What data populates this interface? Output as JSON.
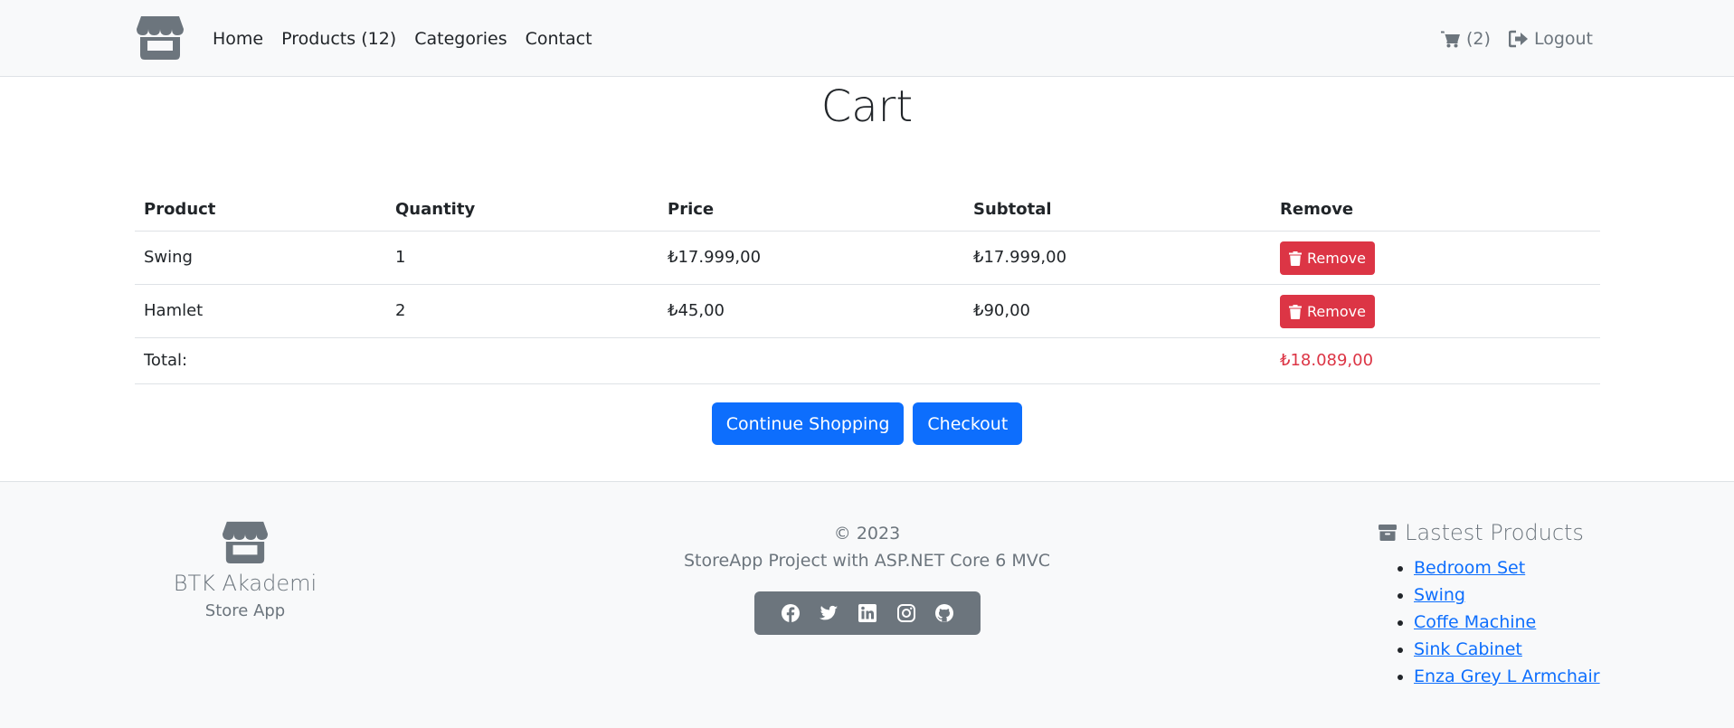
{
  "navbar": {
    "logo_icon": "store-icon",
    "links": [
      {
        "label": "Home"
      },
      {
        "label": "Products (12)"
      },
      {
        "label": "Categories"
      },
      {
        "label": "Contact"
      }
    ],
    "cart": {
      "icon": "cart-icon",
      "count_label": "(2)"
    },
    "logout": {
      "icon": "sign-out-icon",
      "label": "Logout"
    }
  },
  "page": {
    "title": "Cart"
  },
  "cart_table": {
    "headers": [
      "Product",
      "Quantity",
      "Price",
      "Subtotal",
      "Remove"
    ],
    "rows": [
      {
        "product": "Swing",
        "quantity": "1",
        "price": "₺17.999,00",
        "subtotal": "₺17.999,00",
        "remove_label": "Remove"
      },
      {
        "product": "Hamlet",
        "quantity": "2",
        "price": "₺45,00",
        "subtotal": "₺90,00",
        "remove_label": "Remove"
      }
    ],
    "total_label": "Total:",
    "total_value": "₺18.089,00"
  },
  "actions": {
    "continue_label": "Continue Shopping",
    "checkout_label": "Checkout"
  },
  "footer": {
    "brand": {
      "icon": "store-icon",
      "name": "BTK Akademi",
      "sub": "Store App"
    },
    "copyright": "© 2023",
    "project": "StoreApp Project with ASP.NET Core 6 MVC",
    "social": [
      "facebook-icon",
      "twitter-icon",
      "linkedin-icon",
      "instagram-icon",
      "github-icon"
    ],
    "latest": {
      "icon": "box-icon",
      "title": "Lastest Products",
      "items": [
        "Bedroom Set",
        "Swing",
        "Coffe Machine",
        "Sink Cabinet",
        "Enza Grey L Armchair"
      ]
    }
  },
  "colors": {
    "primary": "#0d6efd",
    "danger": "#dc3545",
    "muted": "#6c757d",
    "light_bg": "#f8f9fa"
  }
}
